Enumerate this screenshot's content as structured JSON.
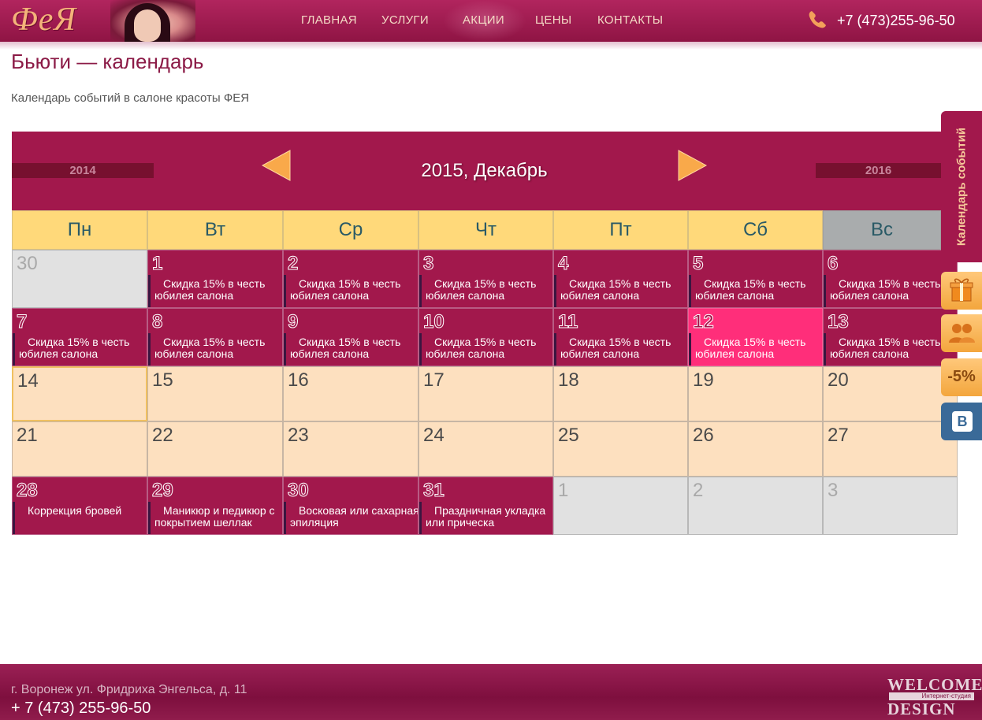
{
  "header": {
    "logo": "ФеЯ",
    "nav": [
      "ГЛАВНАЯ",
      "УСЛУГИ",
      "АКЦИИ",
      "ЦЕНЫ",
      "КОНТАКТЫ"
    ],
    "phone": "+7 (473)255-96-50"
  },
  "page": {
    "title": "Бьюти — календарь",
    "subtitle": "Календарь событий в салоне красоты ФЕЯ"
  },
  "calendar": {
    "prev_year": "2014",
    "next_year": "2016",
    "month_title": "2015, Декабрь",
    "weekdays": [
      "Пн",
      "Вт",
      "Ср",
      "Чт",
      "Пт",
      "Сб",
      "Вс"
    ],
    "weeks": [
      [
        {
          "day": "30",
          "type": "other",
          "text": ""
        },
        {
          "day": "1",
          "type": "event",
          "text": "Скидка 15% в честь юбилея салона"
        },
        {
          "day": "2",
          "type": "event",
          "text": "Скидка 15% в честь юбилея салона"
        },
        {
          "day": "3",
          "type": "event",
          "text": "Скидка 15% в честь юбилея салона"
        },
        {
          "day": "4",
          "type": "event",
          "text": "Скидка 15% в честь юбилея салона"
        },
        {
          "day": "5",
          "type": "event",
          "text": "Скидка 15% в честь юбилея салона"
        },
        {
          "day": "6",
          "type": "event",
          "text": "Скидка 15% в честь юбилея салона"
        }
      ],
      [
        {
          "day": "7",
          "type": "event",
          "text": "Скидка 15% в честь юбилея салона"
        },
        {
          "day": "8",
          "type": "event",
          "text": "Скидка 15% в честь юбилея салона"
        },
        {
          "day": "9",
          "type": "event",
          "text": "Скидка 15% в честь юбилея салона"
        },
        {
          "day": "10",
          "type": "event",
          "text": "Скидка 15% в честь юбилея салона"
        },
        {
          "day": "11",
          "type": "event",
          "text": "Скидка 15% в честь юбилея салона"
        },
        {
          "day": "12",
          "type": "today",
          "text": "Скидка 15% в честь юбилея салона"
        },
        {
          "day": "13",
          "type": "event",
          "text": "Скидка 15% в честь юбилея салона"
        }
      ],
      [
        {
          "day": "14",
          "type": "selected",
          "text": ""
        },
        {
          "day": "15",
          "type": "plain",
          "text": ""
        },
        {
          "day": "16",
          "type": "plain",
          "text": ""
        },
        {
          "day": "17",
          "type": "plain",
          "text": ""
        },
        {
          "day": "18",
          "type": "plain",
          "text": ""
        },
        {
          "day": "19",
          "type": "plain",
          "text": ""
        },
        {
          "day": "20",
          "type": "plain",
          "text": ""
        }
      ],
      [
        {
          "day": "21",
          "type": "plain",
          "text": ""
        },
        {
          "day": "22",
          "type": "plain",
          "text": ""
        },
        {
          "day": "23",
          "type": "plain",
          "text": ""
        },
        {
          "day": "24",
          "type": "plain",
          "text": ""
        },
        {
          "day": "25",
          "type": "plain",
          "text": ""
        },
        {
          "day": "26",
          "type": "plain",
          "text": ""
        },
        {
          "day": "27",
          "type": "plain",
          "text": ""
        }
      ],
      [
        {
          "day": "28",
          "type": "event",
          "text": "Коррекция бровей"
        },
        {
          "day": "29",
          "type": "event",
          "text": "Маникюр и педикюр с покрытием шеллак"
        },
        {
          "day": "30",
          "type": "event",
          "text": "Восковая или сахарная эпиляция"
        },
        {
          "day": "31",
          "type": "event",
          "text": "Праздничная укладка или прическа"
        },
        {
          "day": "1",
          "type": "other",
          "text": ""
        },
        {
          "day": "2",
          "type": "other",
          "text": ""
        },
        {
          "day": "3",
          "type": "other",
          "text": ""
        }
      ]
    ]
  },
  "side_panel": {
    "tab_label": "Календарь событий",
    "buttons": [
      {
        "icon": "gift-icon"
      },
      {
        "icon": "people-icon"
      },
      {
        "icon": "discount-icon",
        "label": "-5%"
      },
      {
        "icon": "vk-icon",
        "label": "В"
      }
    ]
  },
  "footer": {
    "address": "г. Воронеж ул. Фридриха Энгельса, д. 11",
    "phone": "+ 7 (473) 255-96-50",
    "studio_top": "WELCOME",
    "studio_sub": "Интернет-студия",
    "studio_bottom": "DESIGN"
  },
  "colors": {
    "primary": "#a2184c",
    "today": "#ff2e7a",
    "weekday_header": "#ffd97a",
    "plain_day": "#fde0bf",
    "other_month": "#e1e1e1",
    "accent_orange": "#f3a63d"
  }
}
